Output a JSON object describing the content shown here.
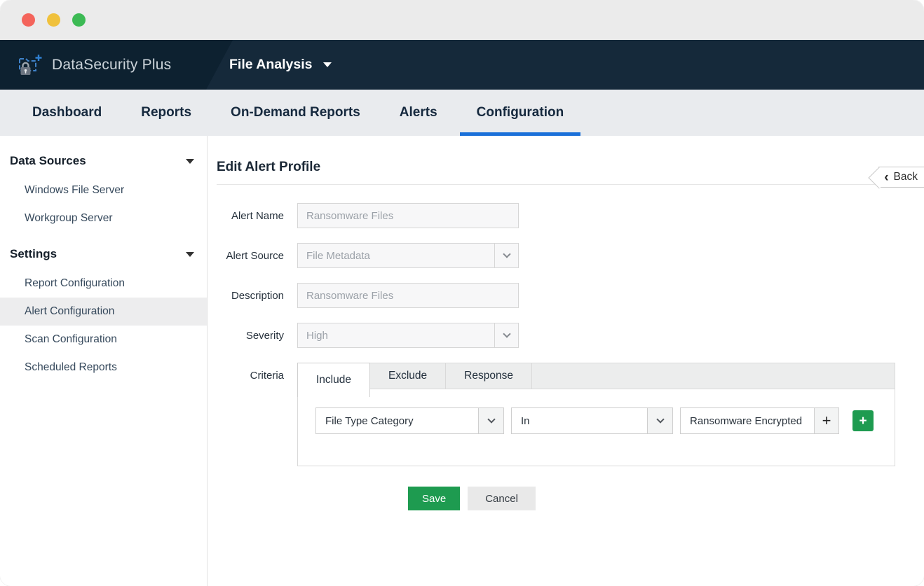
{
  "appbar": {
    "product": "DataSecurity Plus",
    "module": "File Analysis"
  },
  "nav": {
    "tabs": [
      {
        "label": "Dashboard",
        "active": false
      },
      {
        "label": "Reports",
        "active": false
      },
      {
        "label": "On-Demand Reports",
        "active": false
      },
      {
        "label": "Alerts",
        "active": false
      },
      {
        "label": "Configuration",
        "active": true
      }
    ]
  },
  "sidebar": {
    "sections": [
      {
        "title": "Data Sources",
        "items": [
          "Windows File Server",
          "Workgroup Server"
        ]
      },
      {
        "title": "Settings",
        "items": [
          "Report Configuration",
          "Alert Configuration",
          "Scan Configuration",
          "Scheduled Reports"
        ],
        "active_item": "Alert Configuration"
      }
    ]
  },
  "main": {
    "title": "Edit Alert Profile",
    "back": {
      "chevron": "‹",
      "label": "Back"
    },
    "form": {
      "alert_name": {
        "label": "Alert Name",
        "value": "Ransomware Files"
      },
      "alert_source": {
        "label": "Alert Source",
        "value": "File Metadata"
      },
      "description": {
        "label": "Description",
        "value": "Ransomware Files"
      },
      "severity": {
        "label": "Severity",
        "value": "High"
      },
      "criteria": {
        "label": "Criteria",
        "tabs": [
          "Include",
          "Exclude",
          "Response"
        ],
        "active_tab": "Include",
        "condition": {
          "field": "File Type Category",
          "operator": "In",
          "value": "Ransomware Encrypted",
          "add_value_label": "+",
          "add_condition_label": "+"
        }
      }
    },
    "buttons": {
      "save": "Save",
      "cancel": "Cancel"
    }
  },
  "colors": {
    "header_navy": "#15293a",
    "logo_navy": "#0d2130",
    "nav_gray": "#e9ebee",
    "active_tab_underline": "#1a70d9",
    "primary_green": "#1e9b50",
    "sidebar_active_bg": "#ededee"
  }
}
